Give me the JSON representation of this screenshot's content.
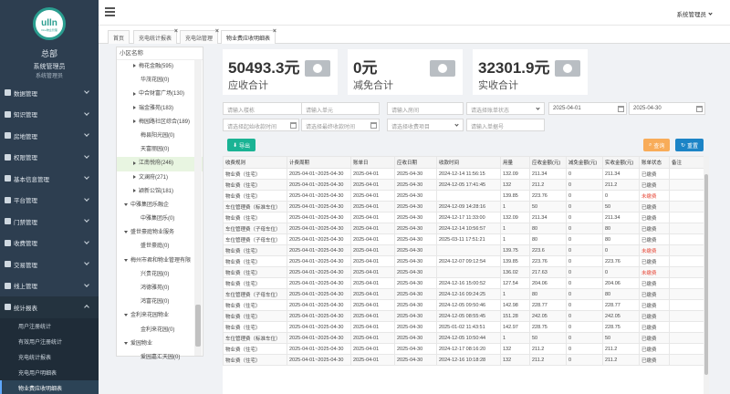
{
  "brand": {
    "logo_text": "ulln",
    "logo_sub": "One物业管理",
    "name": "总部",
    "role": "系统管理员",
    "role2": "系统管理员"
  },
  "menu": [
    {
      "label": "数据管理"
    },
    {
      "label": "知识管理"
    },
    {
      "label": "房地管理"
    },
    {
      "label": "权限管理"
    },
    {
      "label": "基本信息管理"
    },
    {
      "label": "平台管理"
    },
    {
      "label": "门禁管理"
    },
    {
      "label": "收费管理"
    },
    {
      "label": "交易管理"
    },
    {
      "label": "线上管理"
    },
    {
      "label": "统计报表"
    }
  ],
  "submenu": [
    {
      "label": "用户注册统计"
    },
    {
      "label": "有效用户注册统计"
    },
    {
      "label": "充电统计报表"
    },
    {
      "label": "充电用户明细表"
    },
    {
      "label": "物业费应收明细表"
    }
  ],
  "topbar": {
    "user": "系统管理员"
  },
  "tabs": [
    {
      "label": "首页"
    },
    {
      "label": "充电统计报表"
    },
    {
      "label": "充电站管理"
    },
    {
      "label": "物业费应收明细表"
    }
  ],
  "tree": {
    "header": "小区名称",
    "nodes": [
      {
        "label": "梅花金融(595)",
        "type": "collapsed",
        "indent": 18
      },
      {
        "label": "华茂花园(0)",
        "type": "leaf",
        "indent": 26
      },
      {
        "label": "中合财富广场(130)",
        "type": "collapsed",
        "indent": 18
      },
      {
        "label": "瑞金雅苑(183)",
        "type": "collapsed",
        "indent": 18
      },
      {
        "label": "梅园路社区综合(189)",
        "type": "collapsed",
        "indent": 18
      },
      {
        "label": "梅县阳光园(0)",
        "type": "leaf",
        "indent": 26
      },
      {
        "label": "天富丽园(0)",
        "type": "leaf",
        "indent": 26
      },
      {
        "label": "江南悦府(246)",
        "type": "collapsed",
        "indent": 18,
        "selected": true
      },
      {
        "label": "文澜府(271)",
        "type": "collapsed",
        "indent": 18
      },
      {
        "label": "颖新公馆(181)",
        "type": "collapsed",
        "indent": 18
      },
      {
        "label": "中雅集团乐融企",
        "type": "expanded",
        "indent": 8
      },
      {
        "label": "中雅集团乐(0)",
        "type": "leaf",
        "indent": 26
      },
      {
        "label": "盛世豪庭物业服务",
        "type": "expanded",
        "indent": 8
      },
      {
        "label": "盛世豪庭(0)",
        "type": "leaf",
        "indent": 26
      },
      {
        "label": "梅州市君和物业管理有限",
        "type": "expanded",
        "indent": 8
      },
      {
        "label": "兴贵花园(0)",
        "type": "leaf",
        "indent": 26
      },
      {
        "label": "鸿德雅苑(0)",
        "type": "leaf",
        "indent": 26
      },
      {
        "label": "鸿富花园(0)",
        "type": "leaf",
        "indent": 26
      },
      {
        "label": "金利来花园物业",
        "type": "expanded",
        "indent": 8
      },
      {
        "label": "金利来花园(0)",
        "type": "leaf",
        "indent": 26
      },
      {
        "label": "爱园物业",
        "type": "expanded",
        "indent": 8
      },
      {
        "label": "爱园嘉汇天园(0)",
        "type": "leaf",
        "indent": 26
      }
    ]
  },
  "cards": [
    {
      "amount": "50493.3元",
      "label": "应收合计"
    },
    {
      "amount": "0元",
      "label": "减免合计"
    },
    {
      "amount": "32301.9元",
      "label": "实收合计"
    }
  ],
  "filters": {
    "building": "请输入楼栋",
    "unit": "请输入单元",
    "room": "请输入房间",
    "bill_status": "请选择账单状态",
    "date_from": "2025-04-01",
    "date_to": "2025-04-30",
    "receive_from": "请选择起始收款时间",
    "receive_to": "请选择最终收款时间",
    "fee_item": "请选择收费项目",
    "bill_no": "请输入单据号"
  },
  "buttons": {
    "export": "导出",
    "query": "查询",
    "reset": "重置"
  },
  "table": {
    "columns": [
      "收费规则",
      "计费周期",
      "账单日",
      "应收日期",
      "收款时间",
      "用量",
      "应收金额(元)",
      "减免金额(元)",
      "实收金额(元)",
      "账单状态",
      "备注"
    ],
    "rows": [
      [
        "物业费（住宅）",
        "2025-04-01~2025-04-30",
        "2025-04-01",
        "2025-04-30",
        "2024-12-14 11:56:15",
        "132.09",
        "211.34",
        "0",
        "211.34",
        "已缴费",
        ""
      ],
      [
        "物业费（住宅）",
        "2025-04-01~2025-04-30",
        "2025-04-01",
        "2025-04-30",
        "2024-12-05 17:41:45",
        "132",
        "211.2",
        "0",
        "211.2",
        "已缴费",
        ""
      ],
      [
        "物业费（住宅）",
        "2025-04-01~2025-04-30",
        "2025-04-01",
        "2025-04-30",
        "",
        "139.85",
        "223.76",
        "0",
        "0",
        "未缴费",
        ""
      ],
      [
        "车位管理费（标准车位）",
        "2025-04-01~2025-04-30",
        "2025-04-01",
        "2025-04-30",
        "2024-12-09 14:28:16",
        "1",
        "50",
        "0",
        "50",
        "已缴费",
        ""
      ],
      [
        "物业费（住宅）",
        "2025-04-01~2025-04-30",
        "2025-04-01",
        "2025-04-30",
        "2024-12-17 11:33:00",
        "132.09",
        "211.34",
        "0",
        "211.34",
        "已缴费",
        ""
      ],
      [
        "车位管理费（子母车位）",
        "2025-04-01~2025-04-30",
        "2025-04-01",
        "2025-04-30",
        "2024-12-14 10:56:57",
        "1",
        "80",
        "0",
        "80",
        "已缴费",
        ""
      ],
      [
        "车位管理费（子母车位）",
        "2025-04-01~2025-04-30",
        "2025-04-01",
        "2025-04-30",
        "2025-03-11 17:51:21",
        "1",
        "80",
        "0",
        "80",
        "已缴费",
        ""
      ],
      [
        "物业费（住宅）",
        "2025-04-01~2025-04-30",
        "2025-04-01",
        "2025-04-30",
        "",
        "139.75",
        "223.6",
        "0",
        "0",
        "未缴费",
        ""
      ],
      [
        "物业费（住宅）",
        "2025-04-01~2025-04-30",
        "2025-04-01",
        "2025-04-30",
        "2024-12-07 09:12:54",
        "139.85",
        "223.76",
        "0",
        "223.76",
        "已缴费",
        ""
      ],
      [
        "物业费（住宅）",
        "2025-04-01~2025-04-30",
        "2025-04-01",
        "2025-04-30",
        "",
        "136.02",
        "217.63",
        "0",
        "0",
        "未缴费",
        ""
      ],
      [
        "物业费（住宅）",
        "2025-04-01~2025-04-30",
        "2025-04-01",
        "2025-04-30",
        "2024-12-16 15:00:52",
        "127.54",
        "204.06",
        "0",
        "204.06",
        "已缴费",
        ""
      ],
      [
        "车位管理费（子母车位）",
        "2025-04-01~2025-04-30",
        "2025-04-01",
        "2025-04-30",
        "2024-12-16 09:24:25",
        "1",
        "80",
        "0",
        "80",
        "已缴费",
        ""
      ],
      [
        "物业费（住宅）",
        "2025-04-01~2025-04-30",
        "2025-04-01",
        "2025-04-30",
        "2024-12-05 09:50:46",
        "142.98",
        "228.77",
        "0",
        "228.77",
        "已缴费",
        ""
      ],
      [
        "物业费（住宅）",
        "2025-04-01~2025-04-30",
        "2025-04-01",
        "2025-04-30",
        "2024-12-05 08:55:45",
        "151.28",
        "242.05",
        "0",
        "242.05",
        "已缴费",
        ""
      ],
      [
        "物业费（住宅）",
        "2025-04-01~2025-04-30",
        "2025-04-01",
        "2025-04-30",
        "2025-01-02 11:43:51",
        "142.97",
        "228.75",
        "0",
        "228.75",
        "已缴费",
        ""
      ],
      [
        "车位管理费（标准车位）",
        "2025-04-01~2025-04-30",
        "2025-04-01",
        "2025-04-30",
        "2024-12-05 10:50:44",
        "1",
        "50",
        "0",
        "50",
        "已缴费",
        ""
      ],
      [
        "物业费（住宅）",
        "2025-04-01~2025-04-30",
        "2025-04-01",
        "2025-04-30",
        "2024-12-17 08:16:20",
        "132",
        "211.2",
        "0",
        "211.2",
        "已缴费",
        ""
      ],
      [
        "物业费（住宅）",
        "2025-04-01~2025-04-30",
        "2025-04-01",
        "2025-04-30",
        "2024-12-16 10:18:28",
        "132",
        "211.2",
        "0",
        "211.2",
        "已缴费",
        ""
      ]
    ]
  },
  "colors": {
    "sidebar": "#2d3e50",
    "export": "#1ab394",
    "query": "#f8ac59",
    "reset": "#1c84c6",
    "selected_tree": "#e8f5e1"
  }
}
